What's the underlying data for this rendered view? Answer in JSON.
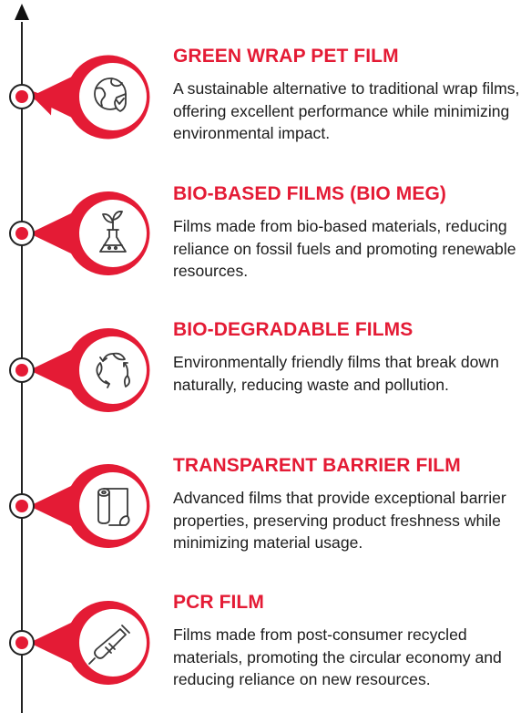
{
  "colors": {
    "accent": "#e41b35",
    "line": "#222222",
    "icon_stroke": "#3a3a3a",
    "text": "#1c1c1c"
  },
  "items": [
    {
      "title": "GREEN WRAP PET FILM",
      "description": "A sustainable alternative to traditional wrap films, offering excellent performance while minimizing environmental impact.",
      "icon": "globe-shield-icon"
    },
    {
      "title": "BIO-BASED FILMS (BIO MEG)",
      "description": "Films made from bio-based materials, reducing reliance on fossil fuels and promoting renewable resources.",
      "icon": "plant-flask-icon"
    },
    {
      "title": "BIO-DEGRADABLE FILMS",
      "description": "Environmentally friendly films that break down naturally, reducing waste and pollution.",
      "icon": "leaf-recycle-icon"
    },
    {
      "title": "TRANSPARENT BARRIER FILM",
      "description": "Advanced films that provide exceptional barrier properties, preserving product freshness while minimizing material usage.",
      "icon": "film-roll-icon"
    },
    {
      "title": "PCR FILM",
      "description": "Films made from post-consumer recycled materials, promoting the circular economy and reducing reliance on new resources.",
      "icon": "test-tube-icon"
    }
  ]
}
